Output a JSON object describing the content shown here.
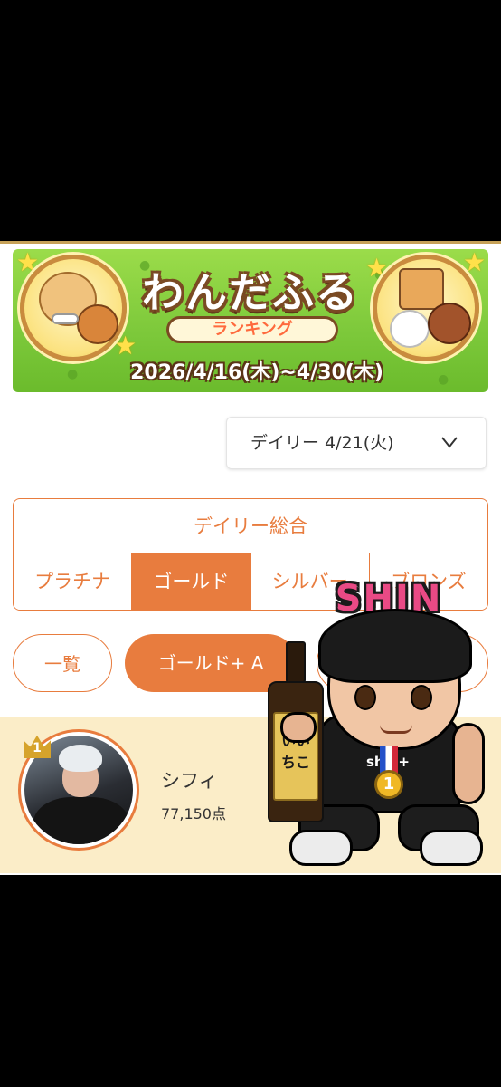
{
  "banner": {
    "title": "わんだふる",
    "subtitle": "ランキング",
    "dates": "2026/4/16(木)~4/30(木)"
  },
  "date_select": {
    "value": "デイリー 4/21(火)",
    "icon": "chevron-down-icon"
  },
  "category": {
    "main": "デイリー総合",
    "tabs": [
      {
        "label": "プラチナ",
        "active": false
      },
      {
        "label": "ゴールド",
        "active": true
      },
      {
        "label": "シルバー",
        "active": false
      },
      {
        "label": "ブロンズ",
        "active": false
      }
    ]
  },
  "filters": {
    "all": "一覧",
    "gold_a": "ゴールド+ A"
  },
  "ranking": [
    {
      "rank": "1",
      "name": "シフィ",
      "score": "77,150点"
    }
  ],
  "overlay": {
    "name": "SHIN",
    "bottle_label": "いいちこ",
    "medal": "1",
    "shirt": "shin+"
  },
  "colors": {
    "accent": "#e87c3e",
    "row_bg": "#fbedc8",
    "banner_green": "#7cc83a"
  }
}
